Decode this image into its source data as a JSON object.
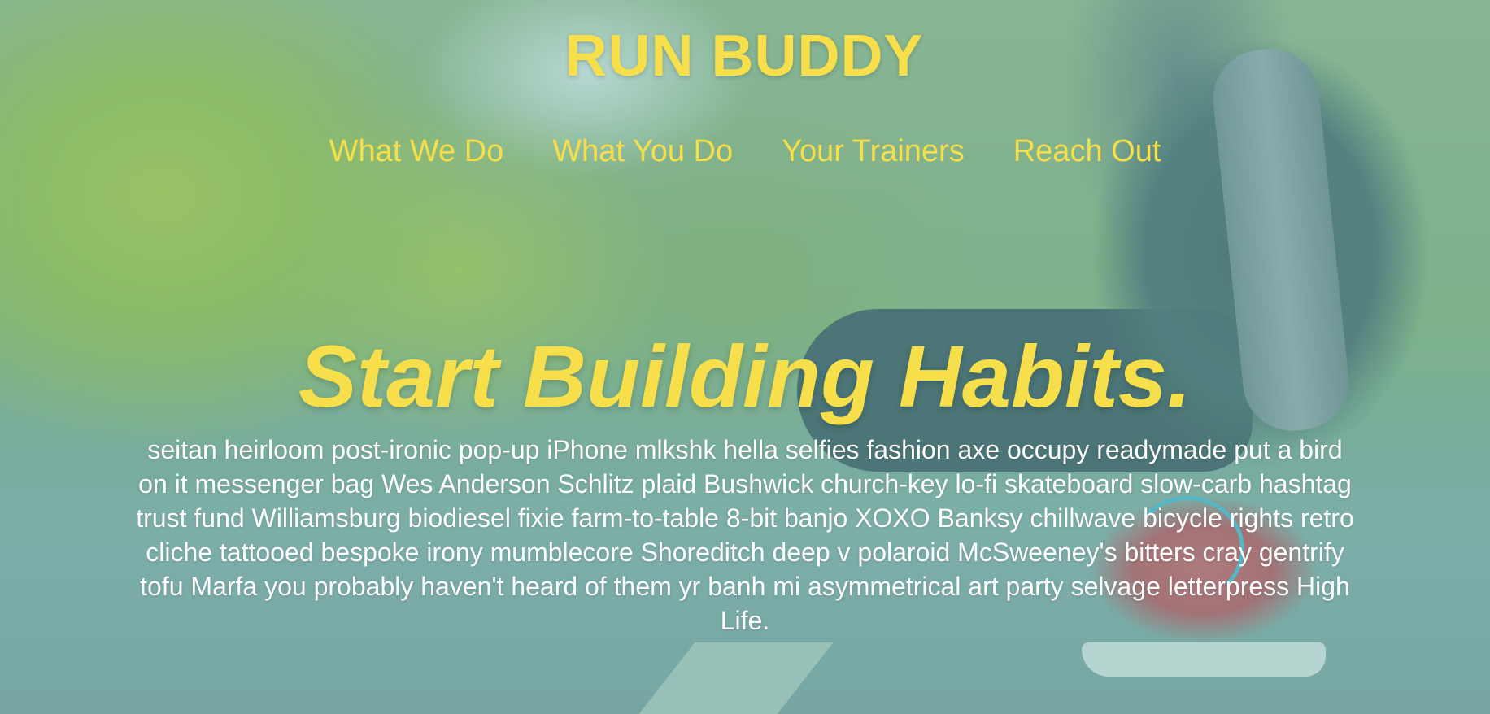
{
  "colors": {
    "accent": "#f6df4a",
    "body_text": "#ffffff",
    "overlay": "#78b9af"
  },
  "header": {
    "brand": "RUN BUDDY",
    "nav": [
      {
        "label": "What We Do"
      },
      {
        "label": "What You Do"
      },
      {
        "label": "Your Trainers"
      },
      {
        "label": "Reach Out"
      }
    ]
  },
  "hero": {
    "headline": "Start Building Habits.",
    "body": "seitan heirloom post-ironic pop-up iPhone mlkshk hella selfies fashion axe occupy readymade put a bird on it messenger bag Wes Anderson Schlitz plaid Bushwick church-key lo-fi skateboard slow-carb hashtag trust fund Williamsburg biodiesel fixie farm-to-table 8-bit banjo XOXO Banksy chillwave bicycle rights retro cliche tattooed bespoke irony mumblecore Shoreditch deep v polaroid McSweeney's bitters cray gentrify tofu Marfa you probably haven't heard of them yr banh mi asymmetrical art party selvage letterpress High Life.",
    "background_image": "runner-tying-shoelace-photo"
  }
}
